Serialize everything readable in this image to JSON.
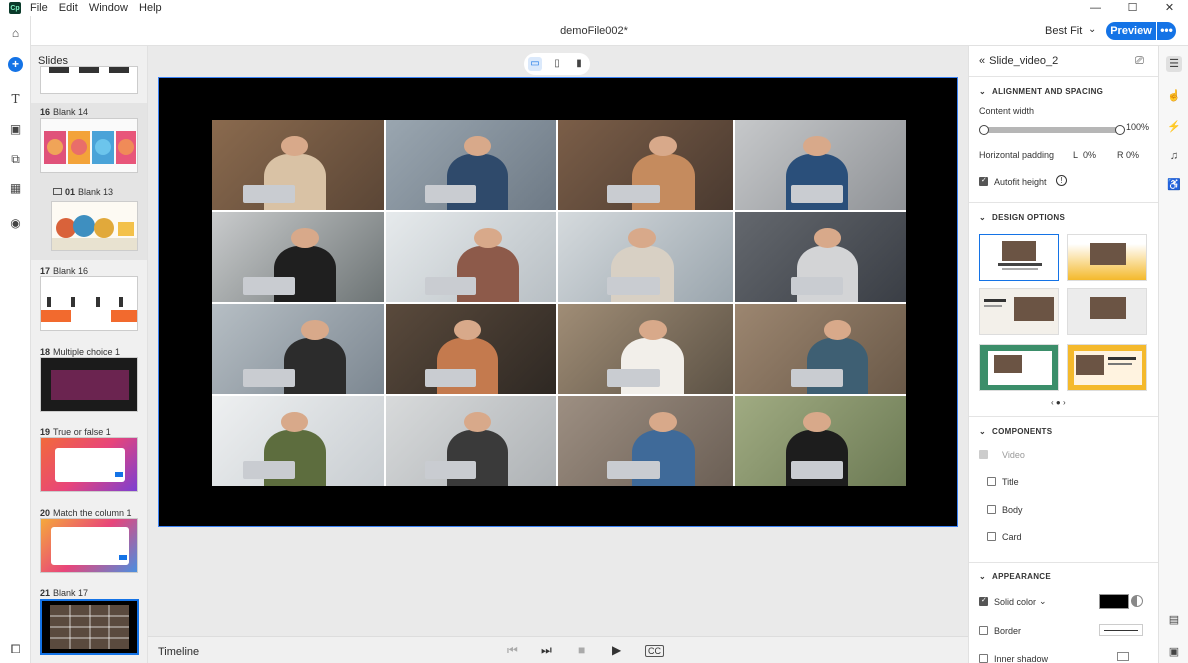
{
  "app": {
    "logo": "Cp"
  },
  "menu": [
    "File",
    "Edit",
    "Window",
    "Help"
  ],
  "window_controls": [
    "—",
    "☐",
    "✕"
  ],
  "toolbar": {
    "document_title": "demoFile002*",
    "zoom_value": "Best Fit",
    "preview_label": "Preview",
    "more_label": "•••"
  },
  "slides_panel": {
    "title": "Slides",
    "items": [
      {
        "number": "16",
        "name": "Blank 14"
      },
      {
        "number": "01",
        "name": "Blank 13"
      },
      {
        "number": "17",
        "name": "Blank 16"
      },
      {
        "number": "18",
        "name": "Multiple choice 1"
      },
      {
        "number": "19",
        "name": "True or false 1"
      },
      {
        "number": "20",
        "name": "Match the column 1"
      },
      {
        "number": "21",
        "name": "Blank 17"
      }
    ]
  },
  "timeline": {
    "label": "Timeline"
  },
  "properties": {
    "object_name": "Slide_video_2",
    "alignment": {
      "title": "ALIGNMENT AND SPACING",
      "content_width_label": "Content width",
      "content_width_value": "100%",
      "content_width_fraction": 1.0,
      "horizontal_padding_label": "Horizontal padding",
      "left_label": "L",
      "left_value": "0%",
      "right_label": "R",
      "right_value": "0%",
      "autofit_label": "Autofit height",
      "autofit_checked": true
    },
    "design_options": {
      "title": "DESIGN OPTIONS"
    },
    "components": {
      "title": "COMPONENTS",
      "items": [
        {
          "label": "Video",
          "checked": true,
          "disabled": true
        },
        {
          "label": "Title",
          "checked": false
        },
        {
          "label": "Body",
          "checked": false
        },
        {
          "label": "Card",
          "checked": false
        }
      ]
    },
    "appearance": {
      "title": "APPEARANCE",
      "solid_color_label": "Solid color",
      "solid_color_value": "#000000",
      "border_label": "Border",
      "inner_shadow_label": "Inner shadow"
    }
  },
  "colors": {
    "accent": "#1473e6",
    "stage": "#000000"
  }
}
